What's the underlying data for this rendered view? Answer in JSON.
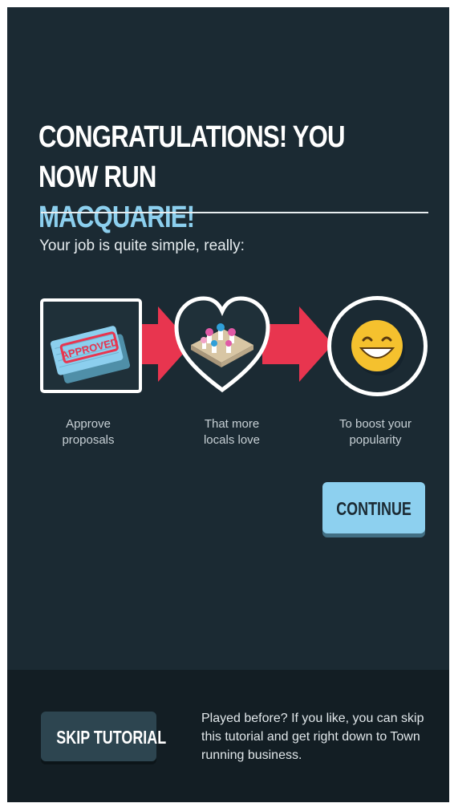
{
  "heading": {
    "line1": "CONGRATULATIONS! YOU NOW RUN",
    "highlight": "MACQUARIE!"
  },
  "intro": "Your job is quite simple, really:",
  "steps": [
    {
      "caption_line1": "Approve",
      "caption_line2": "proposals",
      "icon": "approved-stamp-icon",
      "stamp_text": "APPROVED"
    },
    {
      "caption_line1": "That more",
      "caption_line2": "locals love",
      "icon": "heart-locals-icon"
    },
    {
      "caption_line1": "To boost your",
      "caption_line2": "popularity",
      "icon": "smiley-face-icon"
    }
  ],
  "continue_label": "CONTINUE",
  "footer": {
    "skip_label": "SKIP TUTORIAL",
    "text": "Played before? If you like, you can skip this tutorial and get right down to Town running business."
  },
  "colors": {
    "background": "#1b2a33",
    "accent": "#8ccfee",
    "arrow": "#e8354f",
    "footer": "#131e24"
  }
}
